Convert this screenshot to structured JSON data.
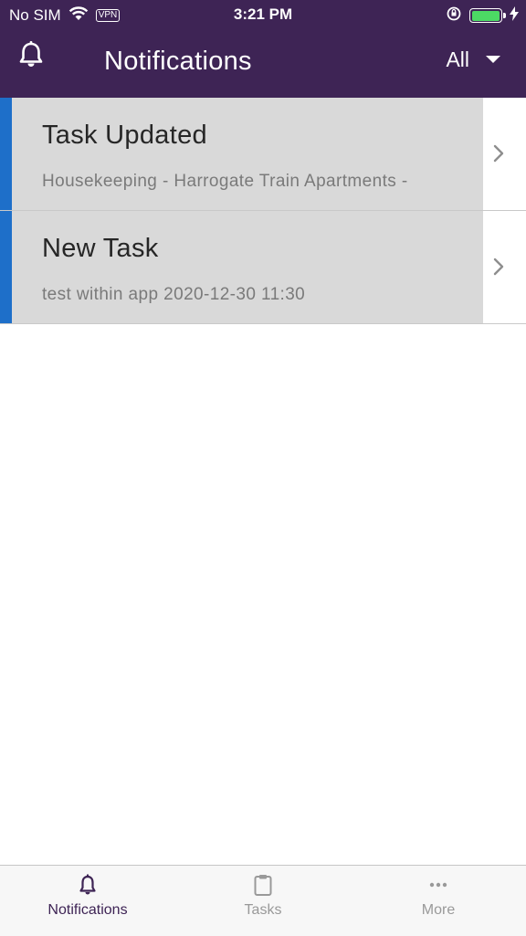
{
  "status_bar": {
    "carrier": "No SIM",
    "vpn": "VPN",
    "time": "3:21 PM"
  },
  "header": {
    "title": "Notifications",
    "filter_label": "All",
    "bell_icon": "bell-icon",
    "background": "#3e2455"
  },
  "notifications": [
    {
      "title": "Task Updated",
      "body": "Housekeeping - Harrogate Train Apartments -",
      "accent": "#1e6fc9"
    },
    {
      "title": "New Task",
      "body": "test  within app 2020-12-30 11:30",
      "accent": "#1e6fc9"
    }
  ],
  "tabbar": {
    "tabs": [
      {
        "label": "Notifications",
        "icon": "bell-icon",
        "active": true
      },
      {
        "label": "Tasks",
        "icon": "clipboard-icon",
        "active": false
      },
      {
        "label": "More",
        "icon": "more-icon",
        "active": false
      }
    ],
    "active_color": "#3e2455",
    "inactive_color": "#999999"
  }
}
